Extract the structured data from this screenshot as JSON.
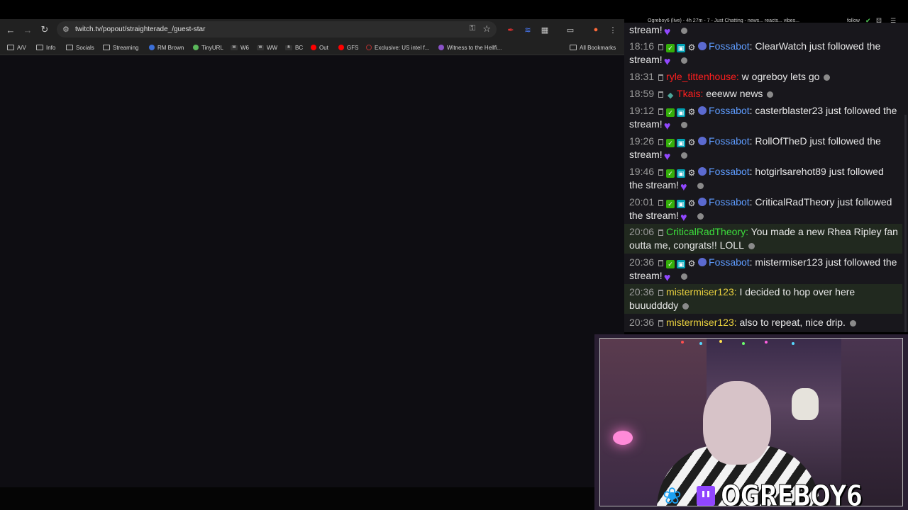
{
  "browser": {
    "url": "twitch.tv/popout/straighterade_/guest-star",
    "bookmarks": [
      {
        "label": "A/V",
        "icon": "folder-icon"
      },
      {
        "label": "Info",
        "icon": "folder-icon"
      },
      {
        "label": "Socials",
        "icon": "folder-icon"
      },
      {
        "label": "Streaming",
        "icon": "folder-icon"
      },
      {
        "label": "RM Brown",
        "icon": "bookmark-icon"
      },
      {
        "label": "TinyURL",
        "icon": "bookmark-icon"
      },
      {
        "label": "W6",
        "icon": "bookmark-icon"
      },
      {
        "label": "WW",
        "icon": "bookmark-icon"
      },
      {
        "label": "BC",
        "icon": "bookmark-icon"
      },
      {
        "label": "Out",
        "icon": "youtube-icon"
      },
      {
        "label": "GFS",
        "icon": "youtube-icon"
      },
      {
        "label": "Exclusive: US intel f...",
        "icon": "globe-icon"
      },
      {
        "label": "Witness to the Hellfi...",
        "icon": "bookmark-icon"
      }
    ],
    "all_bookmarks": "All Bookmarks"
  },
  "stream": {
    "title": "Ogreboy6 (live) - 4h 27m - 7 - Just Chatting - news... reacts... vibes...",
    "follow": "follow"
  },
  "chat": {
    "partial_top": "stream!",
    "messages": [
      {
        "time": "18:16",
        "user": "Fossabot",
        "text": "ClearWatch just followed the stream!",
        "emote": true
      },
      {
        "time": "18:31",
        "user": "ryle_tittenhouse",
        "text": "w ogreboy lets go"
      },
      {
        "time": "18:59",
        "user": "Tkais",
        "text": "eeeww news"
      },
      {
        "time": "19:12",
        "user": "Fossabot",
        "text": "casterblaster23 just followed the stream!",
        "emote": true
      },
      {
        "time": "19:26",
        "user": "Fossabot",
        "text": "RollOfTheD just followed the stream!",
        "emote": true
      },
      {
        "time": "19:46",
        "user": "Fossabot",
        "text": "hotgirlsarehot89 just followed the stream!",
        "emote": true
      },
      {
        "time": "20:01",
        "user": "Fossabot",
        "text": "CriticalRadTheory just followed the stream!",
        "emote": true
      },
      {
        "time": "20:06",
        "user": "CriticalRadTheory",
        "text": "You made a new Rhea Ripley fan outta me, congrats!! LOLL"
      },
      {
        "time": "20:36",
        "user": "Fossabot",
        "text": "mistermiser123 just followed the stream!",
        "emote": true
      },
      {
        "time": "20:36",
        "user": "mistermiser123",
        "text": "I decided to hop over here buuuddddy"
      },
      {
        "time": "20:36",
        "user": "mistermiser123",
        "text": "also to repeat, nice drip."
      }
    ]
  },
  "webcam": {
    "brand_name": "OGREBOY6"
  },
  "colors": {
    "fossabot": "#5e9cff",
    "red_user": "#ff1e1e",
    "green_user": "#3cde3c",
    "yellow_user": "#ead13f",
    "twitch_purple": "#9146ff"
  }
}
